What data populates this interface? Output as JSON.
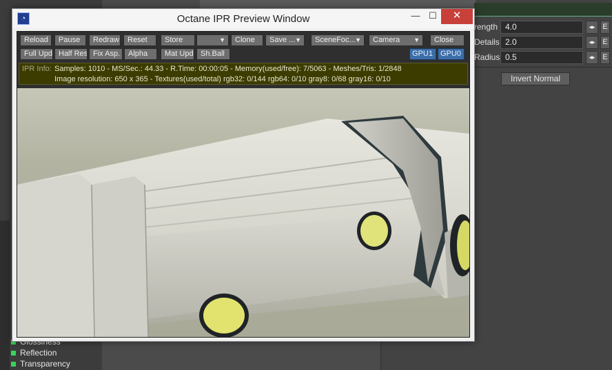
{
  "ipr_window": {
    "title": "Octane IPR Preview Window",
    "app_icon_glyph": "◔",
    "window_controls": {
      "minimize": "—",
      "maximize": "☐",
      "close": "✕"
    },
    "toolbar_row1": [
      {
        "label": "Reload"
      },
      {
        "label": "Pause"
      },
      {
        "label": "Redraw"
      },
      {
        "label": "Reset"
      },
      {
        "label": "Store"
      },
      {
        "label": ""
      },
      {
        "label": "Clone"
      },
      {
        "label": "Save ..."
      },
      {
        "label": "SceneFoc..."
      },
      {
        "label": "Camera"
      },
      {
        "label": "Close"
      }
    ],
    "toolbar_row2": [
      {
        "label": "Full Upd."
      },
      {
        "label": "Half Res"
      },
      {
        "label": "Fix Asp."
      },
      {
        "label": "Alpha"
      },
      {
        "label": "Mat Upd"
      },
      {
        "label": "Sh.Ball"
      },
      {
        "label": "GPU1"
      },
      {
        "label": "GPU0"
      }
    ],
    "info": {
      "label": "IPR Info:",
      "line1": "Samples: 1010  -  MS/Sec.: 44.33  -  R.Time: 00:00:05 - Memory(used/free): 7/5063  -  Meshes/Tris: 1/2848",
      "line2": "Image resolution: 650 x 365 - Textures(used/total) rgb32: 0/144   rgb64: 0/10   gray8: 0/68   gray16: 0/10"
    }
  },
  "properties": {
    "rows": [
      {
        "label": "rength",
        "value": "4.0",
        "spin": "◂▸",
        "env": "E"
      },
      {
        "label": "Details",
        "value": "2.0",
        "spin": "◂▸",
        "env": "E"
      },
      {
        "label": "Radius",
        "value": "0.5",
        "spin": "◂▸",
        "env": "E"
      }
    ],
    "invert_normal_label": "Invert Normal"
  },
  "layers": [
    {
      "label": "Glossiness"
    },
    {
      "label": "Reflection"
    },
    {
      "label": "Transparency"
    }
  ]
}
